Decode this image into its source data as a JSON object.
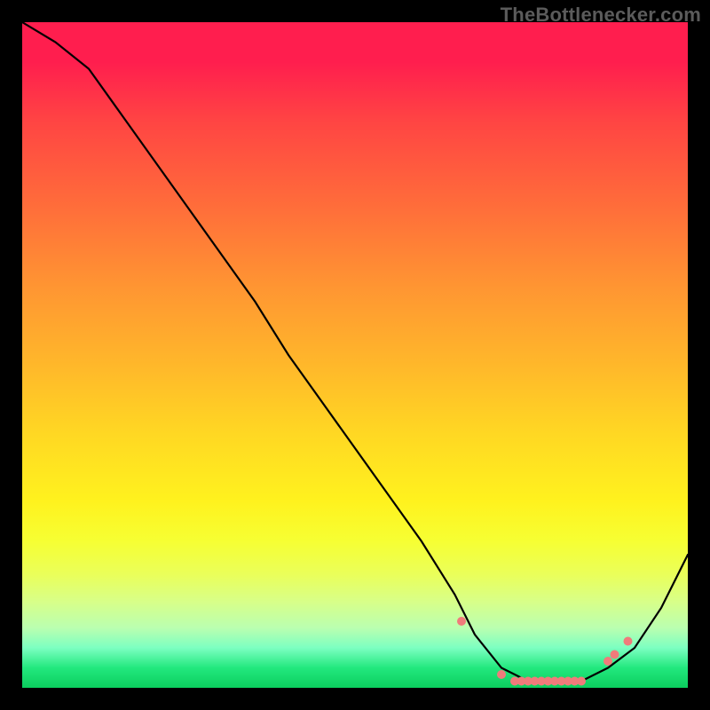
{
  "attribution": "TheBottlenecker.com",
  "chart_data": {
    "type": "line",
    "title": "",
    "xlabel": "",
    "ylabel": "",
    "xlim": [
      0,
      100
    ],
    "ylim": [
      0,
      100
    ],
    "series": [
      {
        "name": "bottleneck-curve",
        "x": [
          0,
          5,
          10,
          15,
          20,
          25,
          30,
          35,
          40,
          45,
          50,
          55,
          60,
          65,
          68,
          72,
          76,
          80,
          84,
          88,
          92,
          96,
          100
        ],
        "y": [
          100,
          97,
          93,
          86,
          79,
          72,
          65,
          58,
          50,
          43,
          36,
          29,
          22,
          14,
          8,
          3,
          1,
          1,
          1,
          3,
          6,
          12,
          20
        ]
      }
    ],
    "markers": {
      "name": "highlight-points",
      "color": "#f07b7b",
      "x": [
        66,
        72,
        74,
        75,
        76,
        77,
        78,
        79,
        80,
        81,
        82,
        83,
        84,
        88,
        89,
        91
      ],
      "y": [
        10,
        2,
        1,
        1,
        1,
        1,
        1,
        1,
        1,
        1,
        1,
        1,
        1,
        4,
        5,
        7
      ]
    },
    "gradient_stops": [
      {
        "pos": 0,
        "color": "#ff1e4e"
      },
      {
        "pos": 50,
        "color": "#ffb92a"
      },
      {
        "pos": 80,
        "color": "#fff21e"
      },
      {
        "pos": 100,
        "color": "#0cce5e"
      }
    ]
  }
}
